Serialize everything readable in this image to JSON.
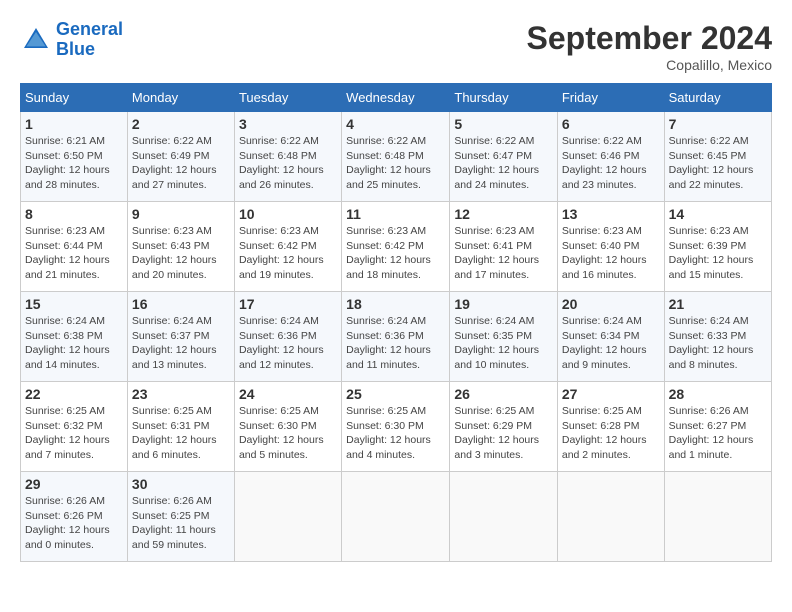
{
  "header": {
    "logo_line1": "General",
    "logo_line2": "Blue",
    "month": "September 2024",
    "location": "Copalillo, Mexico"
  },
  "weekdays": [
    "Sunday",
    "Monday",
    "Tuesday",
    "Wednesday",
    "Thursday",
    "Friday",
    "Saturday"
  ],
  "weeks": [
    [
      {
        "day": "1",
        "info": "Sunrise: 6:21 AM\nSunset: 6:50 PM\nDaylight: 12 hours\nand 28 minutes."
      },
      {
        "day": "2",
        "info": "Sunrise: 6:22 AM\nSunset: 6:49 PM\nDaylight: 12 hours\nand 27 minutes."
      },
      {
        "day": "3",
        "info": "Sunrise: 6:22 AM\nSunset: 6:48 PM\nDaylight: 12 hours\nand 26 minutes."
      },
      {
        "day": "4",
        "info": "Sunrise: 6:22 AM\nSunset: 6:48 PM\nDaylight: 12 hours\nand 25 minutes."
      },
      {
        "day": "5",
        "info": "Sunrise: 6:22 AM\nSunset: 6:47 PM\nDaylight: 12 hours\nand 24 minutes."
      },
      {
        "day": "6",
        "info": "Sunrise: 6:22 AM\nSunset: 6:46 PM\nDaylight: 12 hours\nand 23 minutes."
      },
      {
        "day": "7",
        "info": "Sunrise: 6:22 AM\nSunset: 6:45 PM\nDaylight: 12 hours\nand 22 minutes."
      }
    ],
    [
      {
        "day": "8",
        "info": "Sunrise: 6:23 AM\nSunset: 6:44 PM\nDaylight: 12 hours\nand 21 minutes."
      },
      {
        "day": "9",
        "info": "Sunrise: 6:23 AM\nSunset: 6:43 PM\nDaylight: 12 hours\nand 20 minutes."
      },
      {
        "day": "10",
        "info": "Sunrise: 6:23 AM\nSunset: 6:42 PM\nDaylight: 12 hours\nand 19 minutes."
      },
      {
        "day": "11",
        "info": "Sunrise: 6:23 AM\nSunset: 6:42 PM\nDaylight: 12 hours\nand 18 minutes."
      },
      {
        "day": "12",
        "info": "Sunrise: 6:23 AM\nSunset: 6:41 PM\nDaylight: 12 hours\nand 17 minutes."
      },
      {
        "day": "13",
        "info": "Sunrise: 6:23 AM\nSunset: 6:40 PM\nDaylight: 12 hours\nand 16 minutes."
      },
      {
        "day": "14",
        "info": "Sunrise: 6:23 AM\nSunset: 6:39 PM\nDaylight: 12 hours\nand 15 minutes."
      }
    ],
    [
      {
        "day": "15",
        "info": "Sunrise: 6:24 AM\nSunset: 6:38 PM\nDaylight: 12 hours\nand 14 minutes."
      },
      {
        "day": "16",
        "info": "Sunrise: 6:24 AM\nSunset: 6:37 PM\nDaylight: 12 hours\nand 13 minutes."
      },
      {
        "day": "17",
        "info": "Sunrise: 6:24 AM\nSunset: 6:36 PM\nDaylight: 12 hours\nand 12 minutes."
      },
      {
        "day": "18",
        "info": "Sunrise: 6:24 AM\nSunset: 6:36 PM\nDaylight: 12 hours\nand 11 minutes."
      },
      {
        "day": "19",
        "info": "Sunrise: 6:24 AM\nSunset: 6:35 PM\nDaylight: 12 hours\nand 10 minutes."
      },
      {
        "day": "20",
        "info": "Sunrise: 6:24 AM\nSunset: 6:34 PM\nDaylight: 12 hours\nand 9 minutes."
      },
      {
        "day": "21",
        "info": "Sunrise: 6:24 AM\nSunset: 6:33 PM\nDaylight: 12 hours\nand 8 minutes."
      }
    ],
    [
      {
        "day": "22",
        "info": "Sunrise: 6:25 AM\nSunset: 6:32 PM\nDaylight: 12 hours\nand 7 minutes."
      },
      {
        "day": "23",
        "info": "Sunrise: 6:25 AM\nSunset: 6:31 PM\nDaylight: 12 hours\nand 6 minutes."
      },
      {
        "day": "24",
        "info": "Sunrise: 6:25 AM\nSunset: 6:30 PM\nDaylight: 12 hours\nand 5 minutes."
      },
      {
        "day": "25",
        "info": "Sunrise: 6:25 AM\nSunset: 6:30 PM\nDaylight: 12 hours\nand 4 minutes."
      },
      {
        "day": "26",
        "info": "Sunrise: 6:25 AM\nSunset: 6:29 PM\nDaylight: 12 hours\nand 3 minutes."
      },
      {
        "day": "27",
        "info": "Sunrise: 6:25 AM\nSunset: 6:28 PM\nDaylight: 12 hours\nand 2 minutes."
      },
      {
        "day": "28",
        "info": "Sunrise: 6:26 AM\nSunset: 6:27 PM\nDaylight: 12 hours\nand 1 minute."
      }
    ],
    [
      {
        "day": "29",
        "info": "Sunrise: 6:26 AM\nSunset: 6:26 PM\nDaylight: 12 hours\nand 0 minutes."
      },
      {
        "day": "30",
        "info": "Sunrise: 6:26 AM\nSunset: 6:25 PM\nDaylight: 11 hours\nand 59 minutes."
      },
      null,
      null,
      null,
      null,
      null
    ]
  ]
}
